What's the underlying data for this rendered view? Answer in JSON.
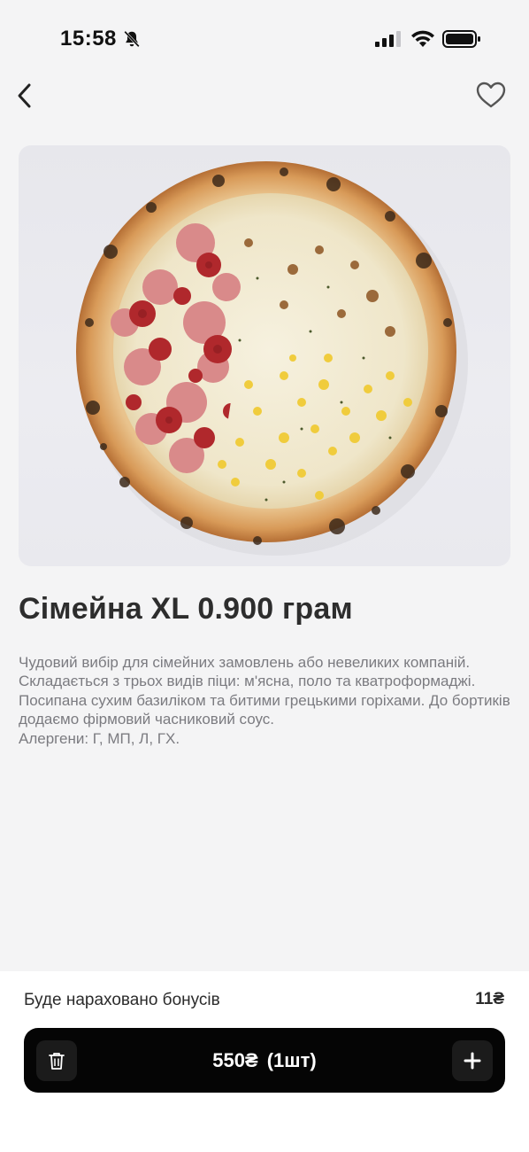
{
  "status_bar": {
    "time": "15:58",
    "icons": [
      "bell-slash-icon",
      "signal-icon",
      "wifi-icon",
      "battery-icon"
    ]
  },
  "nav": {
    "back_icon": "chevron-left-icon",
    "favorite_icon": "heart-outline-icon"
  },
  "product": {
    "image_icon": "pizza-photo",
    "title": "Сімейна XL 0.900 грам",
    "description": [
      "Чудовий вибір для сімейних замовлень або невеликих компаній. Складається з трьох видів піци: м'ясна, поло та кватроформаджі.",
      "Посипана сухим базиліком та битими грецькими горіхами. До бортиків додаємо фірмовий часниковий соус.",
      "Алергени: Г, МП, Л, ГХ."
    ]
  },
  "bonus": {
    "label": "Буде нараховано бонусів",
    "value": "11₴"
  },
  "cart": {
    "price": "550₴",
    "quantity": "(1шт)",
    "remove_icon": "trash-icon",
    "add_icon": "plus-icon"
  },
  "colors": {
    "background": "#f4f4f5",
    "cart_bar": "#050505",
    "text_primary": "#2d2d2d",
    "text_secondary": "#7b7b80"
  }
}
